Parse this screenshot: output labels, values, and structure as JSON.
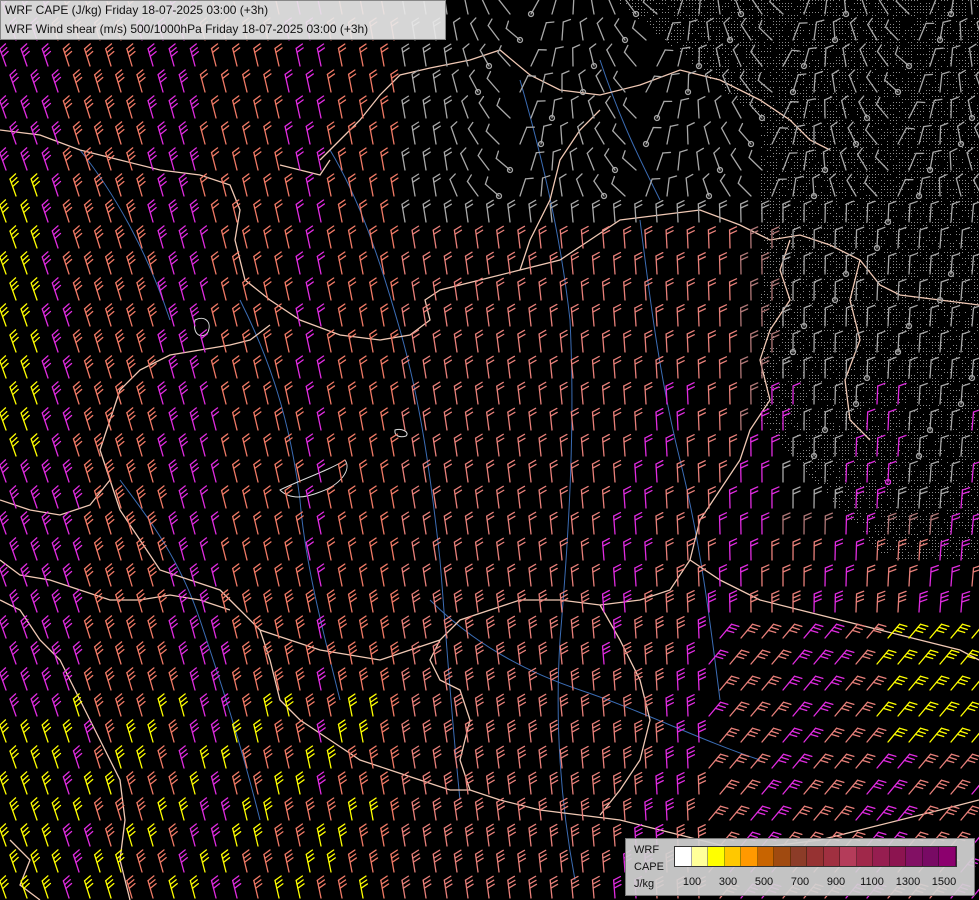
{
  "header": {
    "line1": "WRF CAPE (J/kg) Friday 18-07-2025 03:00 (+3h)",
    "line2": "WRF Wind shear (m/s) 500/1000hPa Friday 18-07-2025 03:00 (+3h)"
  },
  "legend": {
    "model": "WRF",
    "variable": "CAPE",
    "unit": "J/kg",
    "colors": [
      "#ffffff",
      "#ffff99",
      "#ffff00",
      "#ffc800",
      "#ff9900",
      "#c86400",
      "#a04a10",
      "#8c3c28",
      "#963232",
      "#a03040",
      "#b43c5a",
      "#a0284a",
      "#961e50",
      "#8c1450",
      "#821064",
      "#780a64",
      "#8c006e"
    ],
    "tick_labels": [
      "100",
      "300",
      "500",
      "700",
      "900",
      "1100",
      "1300",
      "1500"
    ]
  },
  "map": {
    "background": "#000000",
    "border_color": "#f0c8b4",
    "river_color": "#3b6cb4",
    "barb_colors": {
      "weak": "#a8a8a8",
      "salmon": "#e8807a",
      "coral": "#f07a66",
      "magenta": "#e02ce0",
      "yellow": "#ffff00",
      "rosy": "#b07878"
    }
  }
}
